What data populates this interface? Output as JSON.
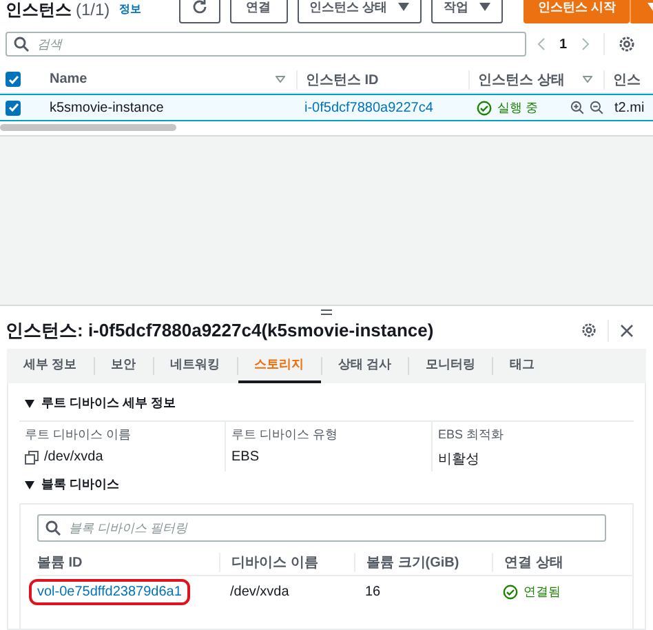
{
  "header": {
    "title": "인스턴스",
    "count": "(1/1)",
    "info_link": "정보",
    "buttons": [
      {
        "kind": "refresh"
      },
      {
        "kind": "plain",
        "label": "연결"
      },
      {
        "kind": "dropdown",
        "label": "인스턴스 상태"
      },
      {
        "kind": "dropdown",
        "label": "작업"
      },
      {
        "kind": "primary",
        "label": "인스턴스 시작"
      },
      {
        "kind": "primary-caret"
      }
    ]
  },
  "search": {
    "placeholder": "검색"
  },
  "pagination": {
    "page": "1"
  },
  "instances_table": {
    "all_checked": true,
    "columns": [
      {
        "label": "Name",
        "sortable": true
      },
      {
        "label": "인스턴스 ID",
        "sortable": false
      },
      {
        "label": "인스턴스 상태",
        "sortable": true
      },
      {
        "label": "인스",
        "sortable": false
      }
    ],
    "rows": [
      {
        "checked": true,
        "selected": true,
        "name": "k5smovie-instance",
        "instance_id": "i-0f5dcf7880a9227c4",
        "state": "실행 중",
        "type": "t2.mi"
      }
    ]
  },
  "details": {
    "title": "인스턴스: i-0f5dcf7880a9227c4(k5smovie-instance)",
    "tabs": [
      {
        "label": "세부 정보",
        "selected": false
      },
      {
        "label": "보안",
        "selected": false
      },
      {
        "label": "네트워킹",
        "selected": false
      },
      {
        "label": "스토리지",
        "selected": true
      },
      {
        "label": "상태 검사",
        "selected": false
      },
      {
        "label": "모니터링",
        "selected": false
      },
      {
        "label": "태그",
        "selected": false
      }
    ],
    "root_device": {
      "heading": "루트 디바이스 세부 정보",
      "expanded": true,
      "fields": [
        {
          "label": "루트 디바이스 이름",
          "value": "/dev/xvda",
          "copyable": true
        },
        {
          "label": "루트 디바이스 유형",
          "value": "EBS",
          "copyable": false
        },
        {
          "label": "EBS 최적화",
          "value": "비활성",
          "copyable": false
        }
      ]
    },
    "block_devices": {
      "heading": "블록 디바이스",
      "expanded": true,
      "filter_placeholder": "블록 디바이스 필터링",
      "columns": [
        "볼륨 ID",
        "디바이스 이름",
        "볼륨 크기(GiB)",
        "연결 상태"
      ],
      "rows": [
        {
          "volume_id": "vol-0e75dffd23879d6a1",
          "highlighted": true,
          "device": "/dev/xvda",
          "size": "16",
          "status": "연결됨"
        }
      ]
    }
  }
}
